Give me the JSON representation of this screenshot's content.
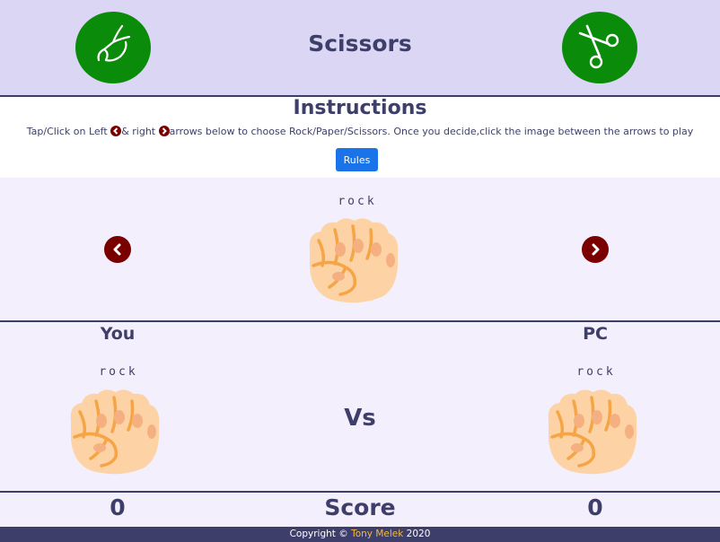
{
  "header": {
    "title": "Scissors",
    "left_icon": "hand-scissors-icon",
    "right_icon": "scissors-icon"
  },
  "instructions": {
    "title": "Instructions",
    "text_part1": "Tap/Click on Left ",
    "text_part2": "& right ",
    "text_part3": "arrows below to choose Rock/Paper/Scissors. Once you decide,click the image between the arrows to play",
    "rules_button": "Rules"
  },
  "chooser": {
    "current_label": "rock",
    "left_arrow_icon": "chevron-left-icon",
    "right_arrow_icon": "chevron-right-icon"
  },
  "battle": {
    "you_label": "You",
    "pc_label": "PC",
    "you_choice": "rock",
    "pc_choice": "rock",
    "vs_label": "Vs"
  },
  "score": {
    "you": "0",
    "label": "Score",
    "pc": "0"
  },
  "footer": {
    "prefix": "Copyright © ",
    "author": "Tony Melek",
    "year": " 2020"
  },
  "colors": {
    "header_bg": "#dcd6f5",
    "panel_bg": "#f3effd",
    "text": "#3d3f6a",
    "green_circle": "#0a8c0a",
    "arrow_red": "#7a0000",
    "button_blue": "#1a73e8",
    "footer_bg": "#3d3f6a",
    "author_color": "#f5b942"
  }
}
